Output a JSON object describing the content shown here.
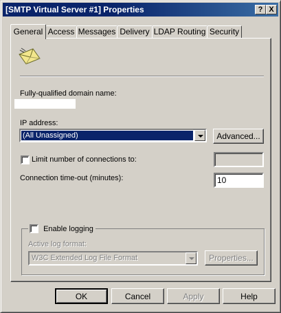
{
  "window": {
    "title": "[SMTP Virtual Server #1] Properties",
    "help_button": "?",
    "close_button": "X"
  },
  "tabs": [
    {
      "label": "General"
    },
    {
      "label": "Access"
    },
    {
      "label": "Messages"
    },
    {
      "label": "Delivery"
    },
    {
      "label": "LDAP Routing"
    },
    {
      "label": "Security"
    }
  ],
  "general": {
    "server_icon": "envelope-icon",
    "fqdn_label": "Fully-qualified domain name:",
    "fqdn_value": "",
    "ip_label": "IP address:",
    "ip_value": "(All Unassigned)",
    "advanced_button": "Advanced...",
    "limit_connections_label": "Limit number of connections to:",
    "limit_connections_value": "",
    "timeout_label": "Connection time-out (minutes):",
    "timeout_value": "10",
    "logging_label": "Enable logging",
    "log_format_label": "Active log format:",
    "log_format_value": "W3C Extended Log File Format",
    "properties_button": "Properties..."
  },
  "footer": {
    "ok": "OK",
    "cancel": "Cancel",
    "apply": "Apply",
    "help": "Help"
  },
  "colors": {
    "titlebar": "#0a246a",
    "face": "#d4d0c8",
    "selection": "#0a246a"
  }
}
